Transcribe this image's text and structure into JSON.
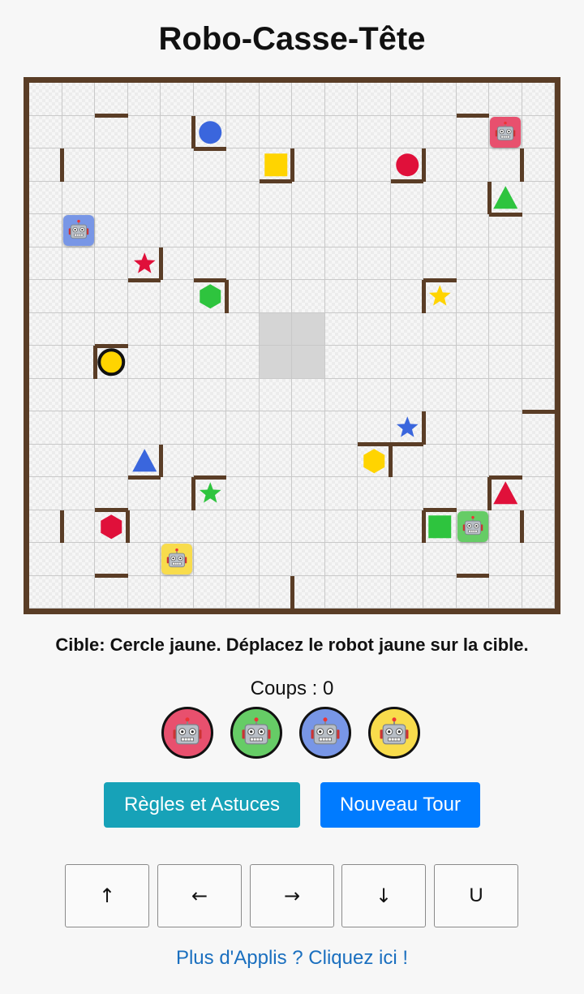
{
  "title": "Robo-Casse-Tête",
  "board": {
    "size": 16,
    "center_cells": [
      [
        7,
        7
      ],
      [
        7,
        8
      ],
      [
        8,
        7
      ],
      [
        8,
        8
      ]
    ],
    "walls": [
      {
        "row": 1,
        "col": 2,
        "side": "top"
      },
      {
        "row": 1,
        "col": 5,
        "side": "left"
      },
      {
        "row": 1,
        "col": 5,
        "side": "bottom"
      },
      {
        "row": 1,
        "col": 13,
        "side": "top"
      },
      {
        "row": 2,
        "col": 1,
        "side": "left"
      },
      {
        "row": 2,
        "col": 7,
        "side": "right"
      },
      {
        "row": 2,
        "col": 7,
        "side": "bottom"
      },
      {
        "row": 2,
        "col": 11,
        "side": "right"
      },
      {
        "row": 2,
        "col": 11,
        "side": "bottom"
      },
      {
        "row": 2,
        "col": 15,
        "side": "left"
      },
      {
        "row": 3,
        "col": 14,
        "side": "left"
      },
      {
        "row": 3,
        "col": 14,
        "side": "bottom"
      },
      {
        "row": 5,
        "col": 3,
        "side": "right"
      },
      {
        "row": 5,
        "col": 3,
        "side": "bottom"
      },
      {
        "row": 6,
        "col": 5,
        "side": "top"
      },
      {
        "row": 6,
        "col": 5,
        "side": "right"
      },
      {
        "row": 6,
        "col": 12,
        "side": "left"
      },
      {
        "row": 6,
        "col": 12,
        "side": "top"
      },
      {
        "row": 8,
        "col": 2,
        "side": "left"
      },
      {
        "row": 8,
        "col": 2,
        "side": "top"
      },
      {
        "row": 10,
        "col": 15,
        "side": "top"
      },
      {
        "row": 10,
        "col": 11,
        "side": "right"
      },
      {
        "row": 10,
        "col": 11,
        "side": "bottom"
      },
      {
        "row": 11,
        "col": 10,
        "side": "top"
      },
      {
        "row": 11,
        "col": 10,
        "side": "right"
      },
      {
        "row": 11,
        "col": 3,
        "side": "right"
      },
      {
        "row": 11,
        "col": 3,
        "side": "bottom"
      },
      {
        "row": 12,
        "col": 5,
        "side": "left"
      },
      {
        "row": 12,
        "col": 5,
        "side": "top"
      },
      {
        "row": 12,
        "col": 14,
        "side": "left"
      },
      {
        "row": 12,
        "col": 14,
        "side": "top"
      },
      {
        "row": 13,
        "col": 1,
        "side": "left"
      },
      {
        "row": 13,
        "col": 2,
        "side": "top"
      },
      {
        "row": 13,
        "col": 2,
        "side": "right"
      },
      {
        "row": 13,
        "col": 12,
        "side": "left"
      },
      {
        "row": 13,
        "col": 12,
        "side": "top"
      },
      {
        "row": 13,
        "col": 14,
        "side": "right"
      },
      {
        "row": 14,
        "col": 2,
        "side": "bottom"
      },
      {
        "row": 14,
        "col": 13,
        "side": "bottom"
      },
      {
        "row": 15,
        "col": 8,
        "side": "left"
      }
    ],
    "targets": [
      {
        "row": 1,
        "col": 5,
        "shape": "circle",
        "color": "#3a66dd",
        "name": "blue-circle-target"
      },
      {
        "row": 2,
        "col": 7,
        "shape": "square",
        "color": "#ffd400",
        "name": "yellow-square-target"
      },
      {
        "row": 2,
        "col": 11,
        "shape": "circle",
        "color": "#e0103a",
        "name": "red-circle-target"
      },
      {
        "row": 3,
        "col": 14,
        "shape": "triangle",
        "color": "#2ec43e",
        "name": "green-triangle-target"
      },
      {
        "row": 5,
        "col": 3,
        "shape": "star",
        "color": "#e0103a",
        "name": "red-star-target"
      },
      {
        "row": 6,
        "col": 5,
        "shape": "hexagon",
        "color": "#2ec43e",
        "name": "green-hexagon-target"
      },
      {
        "row": 6,
        "col": 12,
        "shape": "star",
        "color": "#ffd400",
        "name": "yellow-star-target"
      },
      {
        "row": 8,
        "col": 2,
        "shape": "circle",
        "color": "#ffd400",
        "active": true,
        "name": "yellow-circle-target"
      },
      {
        "row": 10,
        "col": 11,
        "shape": "star",
        "color": "#3a66dd",
        "name": "blue-star-target"
      },
      {
        "row": 11,
        "col": 10,
        "shape": "hexagon",
        "color": "#ffd400",
        "name": "yellow-hexagon-target"
      },
      {
        "row": 11,
        "col": 3,
        "shape": "triangle",
        "color": "#3a66dd",
        "name": "blue-triangle-target"
      },
      {
        "row": 12,
        "col": 5,
        "shape": "star",
        "color": "#2ec43e",
        "name": "green-star-target"
      },
      {
        "row": 12,
        "col": 14,
        "shape": "triangle",
        "color": "#e0103a",
        "name": "red-triangle-target"
      },
      {
        "row": 13,
        "col": 2,
        "shape": "hexagon",
        "color": "#e0103a",
        "name": "red-hexagon-target"
      },
      {
        "row": 13,
        "col": 12,
        "shape": "square",
        "color": "#2ec43e",
        "name": "green-square-target"
      }
    ],
    "robots": [
      {
        "row": 1,
        "col": 14,
        "color": "#e8506e",
        "name": "red-robot"
      },
      {
        "row": 4,
        "col": 1,
        "color": "#7896e6",
        "name": "blue-robot"
      },
      {
        "row": 13,
        "col": 13,
        "color": "#66cc66",
        "name": "green-robot"
      },
      {
        "row": 14,
        "col": 4,
        "color": "#f8dc4c",
        "name": "yellow-robot"
      }
    ]
  },
  "status": "Cible: Cercle jaune. Déplacez le robot jaune sur la cible.",
  "moves_label": "Coups : 0",
  "robot_selector": [
    {
      "color": "#e8506e",
      "name": "select-red-robot-button"
    },
    {
      "color": "#66cc66",
      "name": "select-green-robot-button"
    },
    {
      "color": "#7896e6",
      "name": "select-blue-robot-button"
    },
    {
      "color": "#f8dc4c",
      "name": "select-yellow-robot-button"
    }
  ],
  "buttons": {
    "rules": "Règles et Astuces",
    "rules_color": "#17a2b8",
    "new_round": "Nouveau Tour",
    "new_round_color": "#007bff"
  },
  "controls": {
    "up": "↑",
    "left": "←",
    "right": "→",
    "down": "↓",
    "undo": "U"
  },
  "link": "Plus d'Applis ? Cliquez ici !"
}
